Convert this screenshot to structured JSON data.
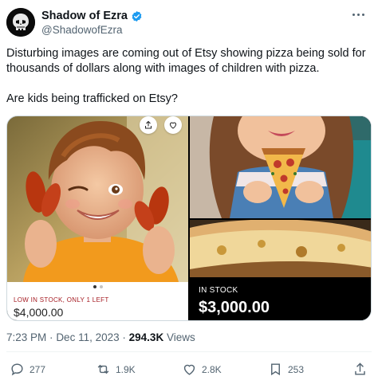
{
  "author": {
    "display_name": "Shadow of Ezra",
    "handle": "@ShadowofEzra"
  },
  "tweet": {
    "paragraph_1": "Disturbing images are coming out of Etsy showing pizza being sold for thousands of dollars along with images of children with pizza.",
    "paragraph_2": "Are kids being trafficked on Etsy?"
  },
  "media": {
    "left_listing": {
      "stock_label": "LOW IN STOCK, ONLY 1 LEFT",
      "price": "$4,000.00"
    },
    "right_listing": {
      "stock_label": "IN STOCK",
      "price": "$3,000.00"
    }
  },
  "meta": {
    "time": "7:23 PM",
    "separator": "·",
    "date": "Dec 11, 2023",
    "views_count": "294.3K",
    "views_label": "Views"
  },
  "actions": {
    "replies": "277",
    "reposts": "1.9K",
    "likes": "2.8K",
    "bookmarks": "253"
  },
  "colors": {
    "verified": "#1d9bf0",
    "text_secondary": "#536471",
    "stock_warning": "#a61d24"
  },
  "icons": [
    "avatar-skull",
    "verified-badge",
    "more-dots",
    "share",
    "heart",
    "reply",
    "repost",
    "like",
    "bookmark",
    "share-up"
  ]
}
